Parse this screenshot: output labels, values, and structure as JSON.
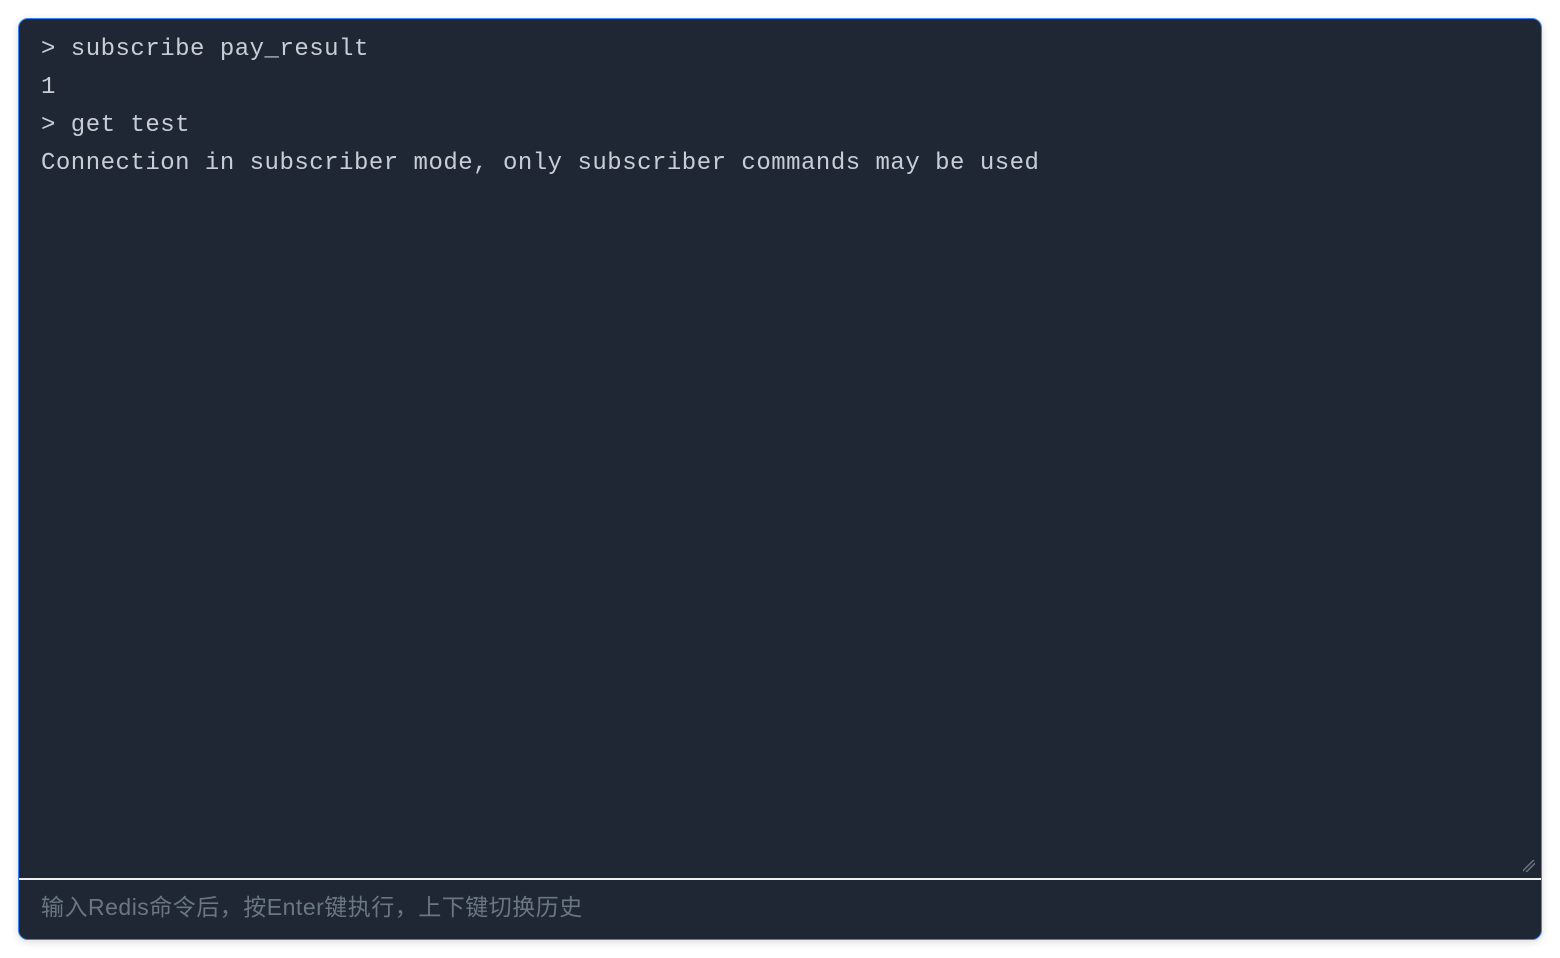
{
  "terminal": {
    "lines": [
      "> subscribe pay_result",
      "1",
      "> get test",
      "Connection in subscriber mode, only subscriber commands may be used"
    ]
  },
  "input": {
    "placeholder": "输入Redis命令后，按Enter键执行，上下键切换历史",
    "value": ""
  }
}
